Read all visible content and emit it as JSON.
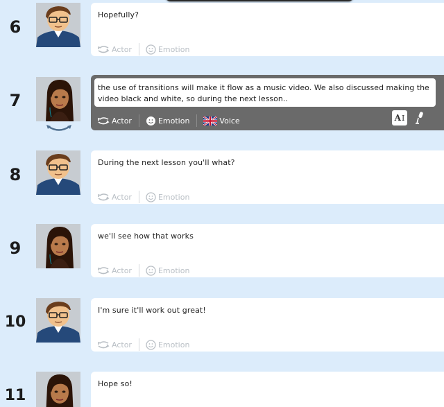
{
  "labels": {
    "actor": "Actor",
    "emotion": "Emotion",
    "voice": "Voice"
  },
  "text_tool": "A",
  "lines": [
    {
      "number": "6",
      "character": "male",
      "text": "Hopefully?"
    },
    {
      "number": "7",
      "character": "female",
      "text": "the use of transitions will make it flow as a music video.  We also discussed making the video black and white, so during the next lesson..",
      "active": true
    },
    {
      "number": "8",
      "character": "male",
      "text": "During the next lesson you'll what?"
    },
    {
      "number": "9",
      "character": "female",
      "text": "we'll see how that works"
    },
    {
      "number": "10",
      "character": "male",
      "text": "I'm sure it'll work out great!"
    },
    {
      "number": "11",
      "character": "female",
      "text": "Hope so!"
    }
  ],
  "colors": {
    "background": "#dcecfb",
    "active_bubble": "#6a6a6a",
    "inactive_meta": "#b9bfc5"
  }
}
